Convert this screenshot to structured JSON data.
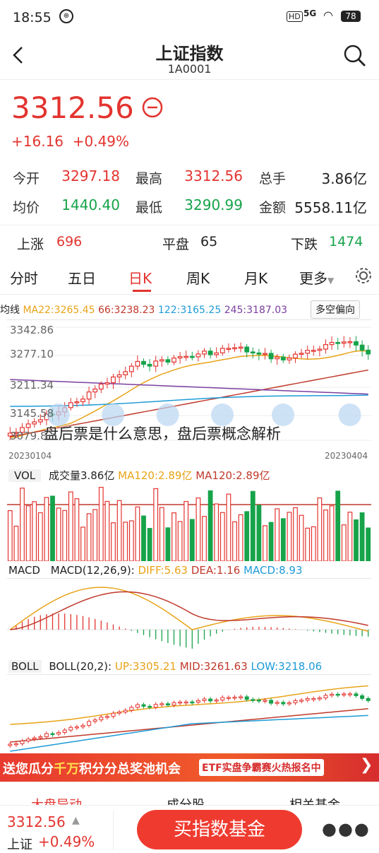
{
  "status_bar": {
    "time": "18:55",
    "battery": "78",
    "network": "5G"
  },
  "header": {
    "title": "上证指数",
    "code": "1A0001"
  },
  "quote": {
    "price": "3312.56",
    "change": "+16.16",
    "change_pct": "+0.49%",
    "stats": [
      {
        "label": "今开",
        "value": "3297.18"
      },
      {
        "label": "最高",
        "value": "3312.56"
      },
      {
        "label": "总手",
        "value": "3.86亿"
      },
      {
        "label": "均价",
        "value": "1440.40"
      },
      {
        "label": "最低",
        "value": "3290.99"
      },
      {
        "label": "金额",
        "value": "5558.11亿"
      }
    ]
  },
  "breadth": {
    "up_label": "上涨",
    "up_value": "696",
    "flat_label": "平盘",
    "flat_value": "65",
    "down_label": "下跌",
    "down_value": "1474"
  },
  "tabs": [
    "分时",
    "五日",
    "日K",
    "周K",
    "月K",
    "更多"
  ],
  "active_tab": "日K",
  "kline": {
    "legend": {
      "prefix": "均线",
      "ma22": "MA22:3265.45",
      "ma66": "66:3238.23",
      "ma122": "122:3165.25",
      "ma245": "245:3187.03",
      "mode": "多空偏向"
    },
    "y_labels": [
      "3342.86",
      "3277.10",
      "3211.34",
      "3145.58",
      "3079.82"
    ],
    "start_date": "20230104",
    "end_date": "20230404"
  },
  "watermark": "盘后票是什么意思，盘后票概念解析",
  "volume": {
    "label": "VOL",
    "vol": "成交量3.86亿",
    "ma1": "MA120:2.89亿",
    "ma2": "MA120:2.89亿"
  },
  "macd": {
    "label": "MACD",
    "params": "MACD(12,26,9):",
    "diff": "DIFF:5.63",
    "dea": "DEA:1.16",
    "macd": "MACD:8.93"
  },
  "boll": {
    "label": "BOLL",
    "params": "BOLL(20,2):",
    "up": "UP:3305.21",
    "mid": "MID:3261.63",
    "low": "LOW:3218.06"
  },
  "banner": {
    "text1": "送您瓜分",
    "highlight": "千万",
    "text2": "积分分总奖池机会",
    "etf": "ETF实盘争霸赛火热报名中"
  },
  "bottom_tabs": [
    "大盘异动",
    "成分股",
    "相关基金"
  ],
  "footer": {
    "price": "3312.56",
    "name": "上证",
    "change_pct": "+0.49%",
    "buy_label": "买指数基金"
  },
  "colors": {
    "up": "#e3342f",
    "down": "#16a34a",
    "ma22": "#e8a317",
    "ma66": "#c0392b",
    "ma122": "#1e9bd7",
    "ma245": "#7b3fa0"
  }
}
